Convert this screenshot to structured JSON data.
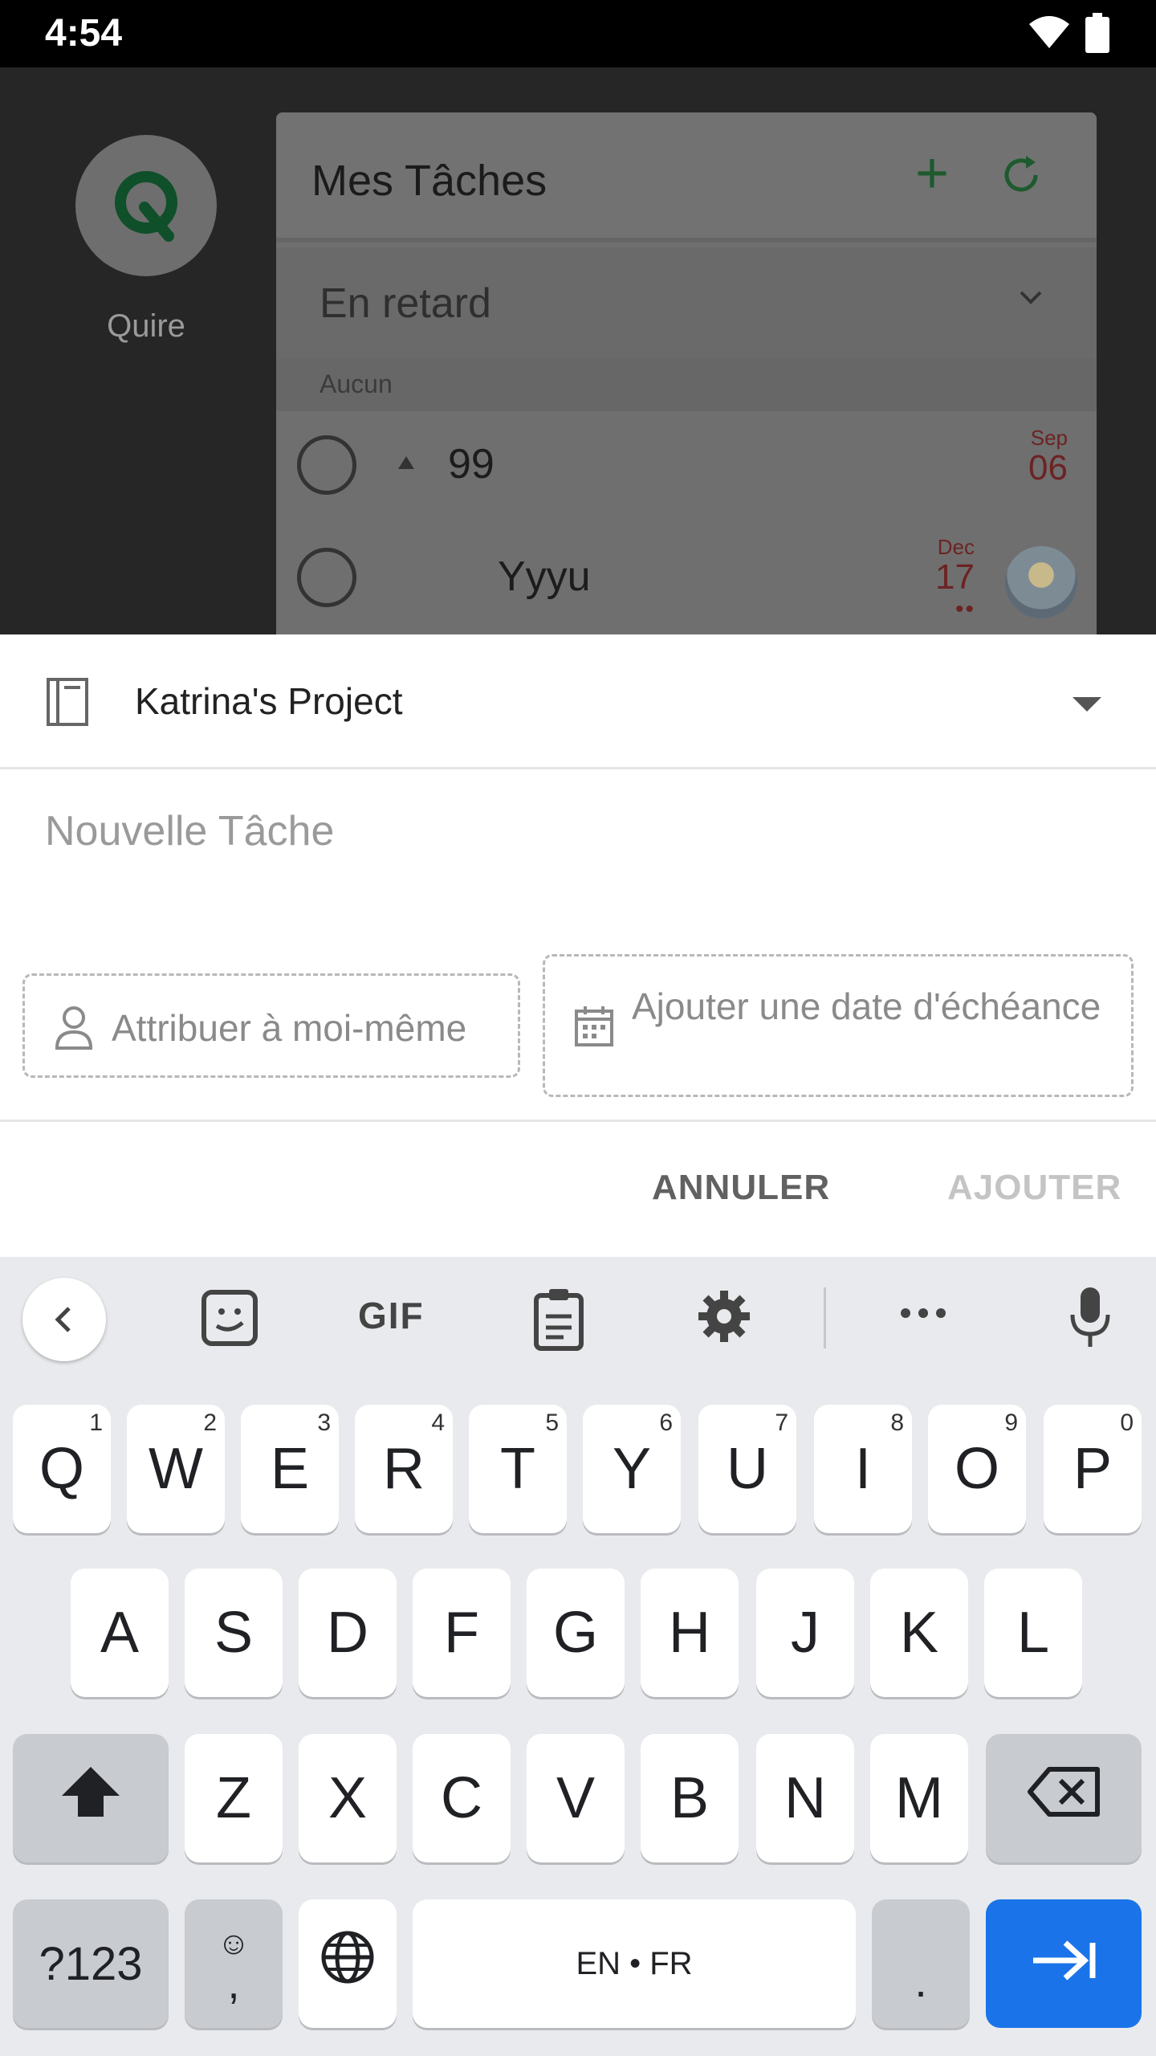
{
  "status": {
    "time": "4:54"
  },
  "background_app": {
    "app_name": "Quire",
    "panel_title": "Mes Tâches",
    "filter_label": "En retard",
    "group_label": "Aucun",
    "tasks": [
      {
        "name": "99",
        "month": "Sep",
        "day": "06"
      },
      {
        "name": "Yyyu",
        "month": "Dec",
        "day": "17",
        "dots": "••"
      }
    ]
  },
  "sheet": {
    "project_name": "Katrina's Project",
    "task_placeholder": "Nouvelle Tâche",
    "assign_label": "Attribuer à moi-même",
    "due_date_label": "Ajouter une date d'échéance",
    "cancel_label": "ANNULER",
    "add_label": "AJOUTER"
  },
  "keyboard": {
    "toolbar_gif": "GIF",
    "row1": [
      {
        "key": "Q",
        "hint": "1"
      },
      {
        "key": "W",
        "hint": "2"
      },
      {
        "key": "E",
        "hint": "3"
      },
      {
        "key": "R",
        "hint": "4"
      },
      {
        "key": "T",
        "hint": "5"
      },
      {
        "key": "Y",
        "hint": "6"
      },
      {
        "key": "U",
        "hint": "7"
      },
      {
        "key": "I",
        "hint": "8"
      },
      {
        "key": "O",
        "hint": "9"
      },
      {
        "key": "P",
        "hint": "0"
      }
    ],
    "row2": [
      "A",
      "S",
      "D",
      "F",
      "G",
      "H",
      "J",
      "K",
      "L"
    ],
    "row3": [
      "Z",
      "X",
      "C",
      "V",
      "B",
      "N",
      "M"
    ],
    "symbols_label": "?123",
    "comma_label": ",",
    "emoji_glyph": "☺",
    "space_label": "EN • FR",
    "period_label": "."
  },
  "colors": {
    "accent_green": "#138a72",
    "overdue_red": "#6c2323",
    "enter_blue": "#1a73e8"
  }
}
